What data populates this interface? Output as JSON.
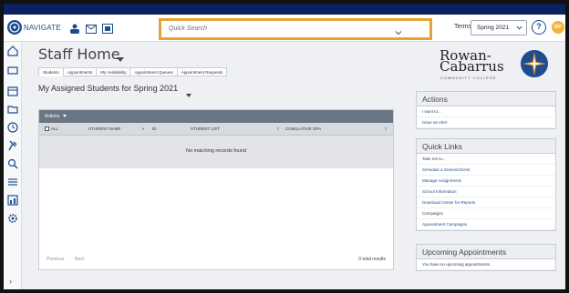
{
  "nav": {
    "label": "NAVIGATE",
    "quick_search_placeholder": "Quick Search",
    "term_label": "Terms",
    "term_value": "Spring 2021",
    "help_label": "?",
    "avatar_initials": "BP"
  },
  "page": {
    "title": "Staff Home",
    "tabs": [
      "Students",
      "Appointments",
      "My Availability",
      "Appointment Queues",
      "Appointment Requests"
    ],
    "section_title": "My Assigned Students for Spring 2021"
  },
  "table": {
    "actions_label": "Actions",
    "headers": {
      "all": "ALL",
      "student_name": "STUDENT NAME",
      "id": "ID",
      "student_list": "STUDENT LIST",
      "gpa": "CUMULATIVE GPA"
    },
    "empty_message": "No matching records found",
    "pager": {
      "previous": "Previous",
      "next": "Next"
    },
    "total": "0 total results"
  },
  "logo": {
    "line1": "Rowan-",
    "line2": "Cabarrus",
    "line3": "COMMUNITY COLLEGE"
  },
  "actions_card": {
    "title": "Actions",
    "items": [
      "I want to...",
      "Issue an Alert"
    ]
  },
  "quick_links": {
    "title": "Quick Links",
    "items": [
      "Take me to...",
      "Schedule a General Event",
      "Manage Assignments",
      "School Information",
      "Download Center for Reports",
      "Campaigns",
      "Appointment Campaigns"
    ]
  },
  "upcoming": {
    "title": "Upcoming Appointments",
    "message": "You have no upcoming appointments."
  },
  "colors": {
    "brand": "#1f4b8f",
    "highlight": "#e8a233"
  }
}
